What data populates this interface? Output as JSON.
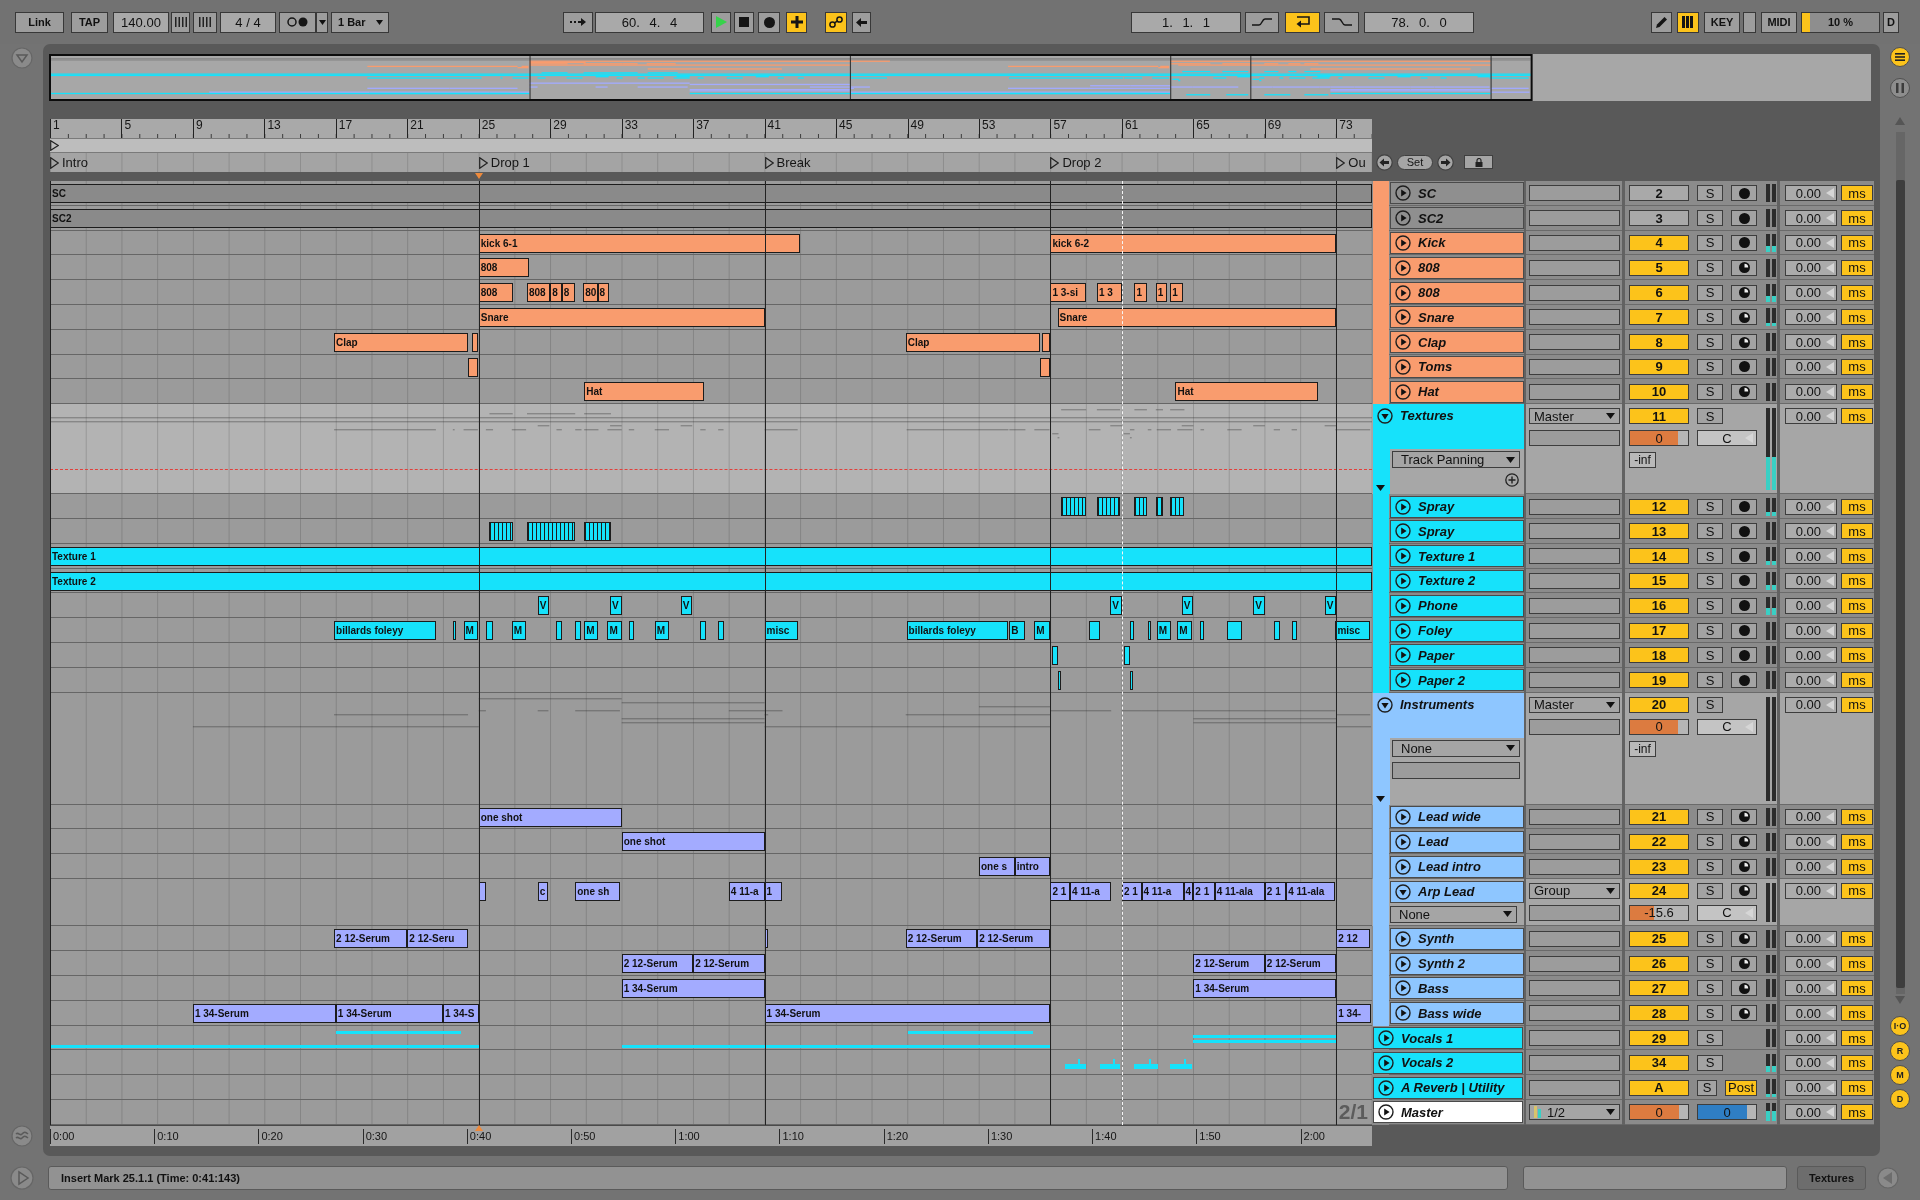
{
  "toolbar": {
    "link": {
      "label": "Link",
      "on": false
    },
    "tap": "TAP",
    "tempo": "140.00",
    "signature": "4 / 4",
    "metronome": {
      "on": false
    },
    "quantization": "1 Bar",
    "follow": {
      "on": false
    },
    "position": "60. 4. 4",
    "transport": [
      {
        "kind": "play",
        "on": true
      },
      {
        "kind": "stop",
        "on": false
      },
      {
        "kind": "record",
        "on": false
      },
      {
        "kind": "overdub",
        "on": true
      }
    ],
    "automation_arm": {
      "on": true
    },
    "back_to_arrangement": {
      "on": false
    },
    "loop_start": "1. 1. 1",
    "loop_switches": [
      {
        "kind": "punch-in",
        "on": false
      },
      {
        "kind": "loop",
        "on": true
      },
      {
        "kind": "punch-out",
        "on": false
      }
    ],
    "loop_length": "78. 0. 0",
    "draw_mode": {
      "on": false
    },
    "computer_keyboard": {
      "on": true
    },
    "key_map": {
      "label": "KEY",
      "on": false
    },
    "midi_map": {
      "label": "MIDI",
      "on": false
    },
    "cpu": {
      "reading": "10 %",
      "level": 0.1
    },
    "disk": {
      "label": "D",
      "on": false
    }
  },
  "overview_toggles": [
    {
      "kind": "lines",
      "on": true
    },
    {
      "kind": "columns",
      "on": false
    }
  ],
  "ruler": {
    "bars": [
      "1",
      "5",
      "9",
      "13",
      "17",
      "21",
      "25",
      "29",
      "33",
      "37",
      "41",
      "45",
      "49",
      "53",
      "57",
      "61",
      "65",
      "69",
      "73"
    ]
  },
  "locators": [
    {
      "label": "Intro"
    },
    {
      "label": "Drop 1"
    },
    {
      "label": "Break"
    },
    {
      "label": "Drop 2"
    },
    {
      "label": "Ou"
    }
  ],
  "locator_controls": {
    "set": "Set"
  },
  "grid": "2/1",
  "time_ruler": [
    "0:00",
    "0:10",
    "0:20",
    "0:30",
    "0:40",
    "0:50",
    "1:00",
    "1:10",
    "1:20",
    "1:30",
    "1:40",
    "1:50",
    "2:00"
  ],
  "tracks": [
    {
      "kind": "continuation",
      "color": "#f99c6e",
      "children": [
        {
          "kind": "track",
          "name": "SC",
          "color": "#8f8f8f",
          "expanded": false,
          "number": "2",
          "active": false,
          "solo": "S",
          "arm": {
            "kind": "dot"
          },
          "delay": "0.00",
          "unit": "ms",
          "clips": {
            "color": "#8a8a8a",
            "items": [
              {
                "kind": "block",
                "name": "SC"
              }
            ]
          }
        },
        {
          "kind": "track",
          "name": "SC2",
          "color": "#8f8f8f",
          "expanded": false,
          "number": "3",
          "active": false,
          "solo": "S",
          "arm": {
            "kind": "dot"
          },
          "delay": "0.00",
          "unit": "ms",
          "clips": {
            "color": "#8a8a8a",
            "items": [
              {
                "kind": "block",
                "name": "SC2"
              }
            ]
          }
        },
        {
          "kind": "track",
          "name": "Kick",
          "color": "#f99c6e",
          "expanded": false,
          "number": "4",
          "active": true,
          "solo": "S",
          "arm": {
            "kind": "dot"
          },
          "meter": {
            "level": 0.35
          },
          "delay": "0.00",
          "unit": "ms",
          "clips": {
            "color": "#f99c6e",
            "items": [
              {
                "kind": "block",
                "name": "kick 6-1"
              },
              {
                "kind": "block",
                "name": "kick 6-2"
              }
            ]
          }
        },
        {
          "kind": "track",
          "name": "808",
          "color": "#f99c6e",
          "expanded": false,
          "number": "5",
          "active": true,
          "solo": "S",
          "arm": {
            "kind": "clock"
          },
          "delay": "0.00",
          "unit": "ms",
          "clips": {
            "color": "#f99c6e",
            "items": [
              {
                "kind": "block",
                "name": "808"
              }
            ]
          }
        },
        {
          "kind": "track",
          "name": "808",
          "color": "#f99c6e",
          "expanded": false,
          "number": "6",
          "active": true,
          "solo": "S",
          "arm": {
            "kind": "clock"
          },
          "meter": {
            "level": 0.3
          },
          "delay": "0.00",
          "unit": "ms",
          "clips": {
            "color": "#f99c6e",
            "items": [
              {
                "kind": "block",
                "name": "808"
              },
              {
                "kind": "block",
                "name": "808"
              },
              {
                "kind": "block",
                "name": "8"
              },
              {
                "kind": "block",
                "name": "8"
              },
              {
                "kind": "block",
                "name": "80"
              },
              {
                "kind": "block",
                "name": "8"
              },
              {
                "kind": "block",
                "name": "1 3-si"
              },
              {
                "kind": "block",
                "name": "1 3"
              },
              {
                "kind": "block",
                "name": "1"
              },
              {
                "kind": "block",
                "name": "1"
              },
              {
                "kind": "block",
                "name": "1"
              }
            ]
          }
        },
        {
          "kind": "track",
          "name": "Snare",
          "color": "#f99c6e",
          "expanded": false,
          "number": "7",
          "active": true,
          "solo": "S",
          "arm": {
            "kind": "clock"
          },
          "meter": {
            "level": 0.2
          },
          "delay": "0.00",
          "unit": "ms",
          "clips": {
            "color": "#f99c6e",
            "items": [
              {
                "kind": "block",
                "name": "Snare"
              },
              {
                "kind": "block",
                "name": "Snare"
              }
            ]
          }
        },
        {
          "kind": "track",
          "name": "Clap",
          "color": "#f99c6e",
          "expanded": false,
          "number": "8",
          "active": true,
          "solo": "S",
          "arm": {
            "kind": "clock"
          },
          "delay": "0.00",
          "unit": "ms",
          "clips": {
            "color": "#f99c6e",
            "items": [
              {
                "kind": "block",
                "name": "Clap"
              },
              {
                "kind": "block"
              },
              {
                "kind": "block",
                "name": "Clap"
              },
              {
                "kind": "block"
              }
            ]
          }
        },
        {
          "kind": "track",
          "name": "Toms",
          "color": "#f99c6e",
          "expanded": false,
          "number": "9",
          "active": true,
          "solo": "S",
          "arm": {
            "kind": "dot"
          },
          "delay": "0.00",
          "unit": "ms",
          "clips": {
            "color": "#f99c6e",
            "items": [
              {
                "kind": "block"
              },
              {
                "kind": "block"
              }
            ]
          }
        },
        {
          "kind": "track",
          "name": "Hat",
          "color": "#f99c6e",
          "expanded": false,
          "number": "10",
          "active": true,
          "solo": "S",
          "arm": {
            "kind": "clock"
          },
          "delay": "0.00",
          "unit": "ms",
          "clips": {
            "color": "#f99c6e",
            "items": [
              {
                "kind": "block",
                "name": "Hat"
              },
              {
                "kind": "block",
                "name": "Hat"
              }
            ]
          }
        }
      ]
    },
    {
      "kind": "group",
      "name": "Textures",
      "color": "#16e2fb",
      "expanded": true,
      "output": "Master",
      "number": "11",
      "active": true,
      "solo": "S",
      "volume": {
        "value": "0",
        "level": 0.82
      },
      "pan": "C",
      "peak": "-inf",
      "automation": {
        "kind": "parameter",
        "chooser": "Track Panning"
      },
      "meter": {
        "level": 0.4
      },
      "delay": "0.00",
      "unit": "ms",
      "children": [
        {
          "kind": "track",
          "name": "Spray",
          "color": "#16e2fb",
          "expanded": false,
          "number": "12",
          "active": true,
          "solo": "S",
          "arm": {
            "kind": "dot"
          },
          "meter": {
            "level": 0.2
          },
          "delay": "0.00",
          "unit": "ms",
          "clips": {
            "color": "#16e2fb",
            "items": [
              {
                "kind": "sliced"
              },
              {
                "kind": "sliced"
              },
              {
                "kind": "sliced"
              },
              {
                "kind": "sliced"
              },
              {
                "kind": "sliced"
              }
            ]
          }
        },
        {
          "kind": "track",
          "name": "Spray",
          "color": "#16e2fb",
          "expanded": false,
          "number": "13",
          "active": true,
          "solo": "S",
          "arm": {
            "kind": "dot"
          },
          "delay": "0.00",
          "unit": "ms",
          "clips": {
            "color": "#16e2fb",
            "items": [
              {
                "kind": "sliced"
              },
              {
                "kind": "sliced"
              },
              {
                "kind": "sliced"
              }
            ]
          }
        },
        {
          "kind": "track",
          "name": "Texture 1",
          "color": "#16e2fb",
          "expanded": false,
          "number": "14",
          "active": true,
          "solo": "S",
          "arm": {
            "kind": "dot"
          },
          "meter": {
            "level": 0.25
          },
          "delay": "0.00",
          "unit": "ms",
          "clips": {
            "color": "#16e2fb",
            "items": [
              {
                "kind": "block",
                "name": "Texture 1"
              }
            ]
          }
        },
        {
          "kind": "track",
          "name": "Texture 2",
          "color": "#16e2fb",
          "expanded": false,
          "number": "15",
          "active": true,
          "solo": "S",
          "arm": {
            "kind": "dot"
          },
          "meter": {
            "level": 0.3
          },
          "delay": "0.00",
          "unit": "ms",
          "clips": {
            "color": "#16e2fb",
            "items": [
              {
                "kind": "block",
                "name": "Texture 2"
              }
            ]
          }
        },
        {
          "kind": "track",
          "name": "Phone",
          "color": "#16e2fb",
          "expanded": false,
          "number": "16",
          "active": true,
          "solo": "S",
          "arm": {
            "kind": "dot"
          },
          "meter": {
            "level": 0.35
          },
          "delay": "0.00",
          "unit": "ms",
          "clips": {
            "color": "#16e2fb",
            "items": [
              {
                "kind": "block",
                "name": "V"
              },
              {
                "kind": "block",
                "name": "V"
              },
              {
                "kind": "block",
                "name": "V"
              },
              {
                "kind": "block",
                "name": "V"
              },
              {
                "kind": "block",
                "name": "V"
              },
              {
                "kind": "block",
                "name": "V"
              },
              {
                "kind": "block",
                "name": "V"
              }
            ]
          }
        },
        {
          "kind": "track",
          "name": "Foley",
          "color": "#16e2fb",
          "expanded": false,
          "number": "17",
          "active": true,
          "solo": "S",
          "arm": {
            "kind": "dot"
          },
          "delay": "0.00",
          "unit": "ms",
          "clips": {
            "color": "#16e2fb",
            "items": [
              {
                "kind": "block",
                "name": "billards foleyy"
              },
              {
                "kind": "block"
              },
              {
                "kind": "block",
                "name": "M"
              },
              {
                "kind": "block"
              },
              {
                "kind": "block",
                "name": "M"
              },
              {
                "kind": "block"
              },
              {
                "kind": "block"
              },
              {
                "kind": "block",
                "name": "M"
              },
              {
                "kind": "block",
                "name": "M"
              },
              {
                "kind": "block"
              },
              {
                "kind": "block",
                "name": "M"
              },
              {
                "kind": "block"
              },
              {
                "kind": "block"
              },
              {
                "kind": "block",
                "name": "misc"
              },
              {
                "kind": "block",
                "name": "billards foleyy"
              },
              {
                "kind": "block",
                "name": "B"
              },
              {
                "kind": "block",
                "name": "M"
              },
              {
                "kind": "block"
              },
              {
                "kind": "block"
              },
              {
                "kind": "block"
              },
              {
                "kind": "block",
                "name": "M"
              },
              {
                "kind": "block",
                "name": "M"
              },
              {
                "kind": "block"
              },
              {
                "kind": "block"
              },
              {
                "kind": "block"
              },
              {
                "kind": "block"
              },
              {
                "kind": "block",
                "name": "misc"
              }
            ]
          }
        },
        {
          "kind": "track",
          "name": "Paper",
          "color": "#16e2fb",
          "expanded": false,
          "number": "18",
          "active": true,
          "solo": "S",
          "arm": {
            "kind": "dot"
          },
          "delay": "0.00",
          "unit": "ms",
          "clips": {
            "color": "#16e2fb",
            "items": [
              {
                "kind": "block"
              },
              {
                "kind": "block"
              }
            ]
          }
        },
        {
          "kind": "track",
          "name": "Paper 2",
          "color": "#16e2fb",
          "expanded": false,
          "number": "19",
          "active": true,
          "solo": "S",
          "arm": {
            "kind": "dot"
          },
          "delay": "0.00",
          "unit": "ms",
          "clips": {
            "color": "#16e2fb",
            "items": [
              {
                "kind": "block"
              },
              {
                "kind": "block"
              }
            ]
          }
        }
      ]
    },
    {
      "kind": "group",
      "name": "Instruments",
      "color": "#8ec6ff",
      "expanded": true,
      "output": "Master",
      "number": "20",
      "active": true,
      "solo": "S",
      "volume": {
        "value": "0",
        "level": 0.82
      },
      "pan": "C",
      "peak": "-inf",
      "automation": {
        "kind": "device",
        "chooser": "None"
      },
      "delay": "0.00",
      "unit": "ms",
      "children": [
        {
          "kind": "track",
          "name": "Lead wide",
          "color": "#8ec6ff",
          "expanded": false,
          "number": "21",
          "active": true,
          "solo": "S",
          "arm": {
            "kind": "clock"
          },
          "delay": "0.00",
          "unit": "ms",
          "clips": {
            "color": "#a3abff",
            "items": [
              {
                "kind": "block",
                "name": "one shot"
              }
            ]
          }
        },
        {
          "kind": "track",
          "name": "Lead",
          "color": "#8ec6ff",
          "expanded": false,
          "number": "22",
          "active": true,
          "solo": "S",
          "arm": {
            "kind": "clock"
          },
          "delay": "0.00",
          "unit": "ms",
          "clips": {
            "color": "#a3abff",
            "items": [
              {
                "kind": "block",
                "name": "one shot"
              }
            ]
          }
        },
        {
          "kind": "track",
          "name": "Lead intro",
          "color": "#8ec6ff",
          "expanded": false,
          "number": "23",
          "active": true,
          "solo": "S",
          "arm": {
            "kind": "clock"
          },
          "delay": "0.00",
          "unit": "ms",
          "clips": {
            "color": "#a3abff",
            "items": [
              {
                "kind": "block",
                "name": "one s"
              },
              {
                "kind": "block",
                "name": "intro"
              }
            ]
          }
        },
        {
          "kind": "track",
          "name": "Arp Lead",
          "color": "#8ec6ff",
          "expanded": true,
          "output": "Group",
          "number": "24",
          "active": true,
          "solo": "S",
          "arm": {
            "kind": "clock"
          },
          "volume": {
            "value": "-15.6",
            "level": 0.42
          },
          "pan": "C",
          "chooser": "None",
          "delay": "0.00",
          "unit": "ms",
          "clips": {
            "color": "#a3abff",
            "items": [
              {
                "kind": "block"
              },
              {
                "kind": "block",
                "name": "c"
              },
              {
                "kind": "block",
                "name": "one sh"
              },
              {
                "kind": "block",
                "name": "4 11-a"
              },
              {
                "kind": "block",
                "name": "1"
              },
              {
                "kind": "block",
                "name": "2 1"
              },
              {
                "kind": "block",
                "name": "4 11-a"
              },
              {
                "kind": "block",
                "name": "2 1"
              },
              {
                "kind": "block",
                "name": "4 11-a"
              },
              {
                "kind": "block",
                "name": "4"
              },
              {
                "kind": "block",
                "name": "2 1"
              },
              {
                "kind": "block",
                "name": "4 11-ala"
              },
              {
                "kind": "block",
                "name": "2 1"
              },
              {
                "kind": "block",
                "name": "4 11-ala"
              }
            ]
          }
        },
        {
          "kind": "track",
          "name": "Synth",
          "color": "#8ec6ff",
          "expanded": false,
          "number": "25",
          "active": true,
          "solo": "S",
          "arm": {
            "kind": "clock"
          },
          "delay": "0.00",
          "unit": "ms",
          "clips": {
            "color": "#a3abff",
            "items": [
              {
                "kind": "block",
                "name": "2 12-Serum"
              },
              {
                "kind": "block",
                "name": "2 12-Seru"
              },
              {
                "kind": "block"
              },
              {
                "kind": "block",
                "name": "2 12-Serum"
              },
              {
                "kind": "block",
                "name": "2 12-Serum"
              },
              {
                "kind": "block",
                "name": "2 12"
              }
            ]
          }
        },
        {
          "kind": "track",
          "name": "Synth 2",
          "color": "#8ec6ff",
          "expanded": false,
          "number": "26",
          "active": true,
          "solo": "S",
          "arm": {
            "kind": "clock"
          },
          "delay": "0.00",
          "unit": "ms",
          "clips": {
            "color": "#a3abff",
            "items": [
              {
                "kind": "block",
                "name": "2 12-Serum"
              },
              {
                "kind": "block",
                "name": "2 12-Serum"
              },
              {
                "kind": "block",
                "name": "2 12-Serum"
              },
              {
                "kind": "block",
                "name": "2 12-Serum"
              }
            ]
          }
        },
        {
          "kind": "track",
          "name": "Bass",
          "color": "#8ec6ff",
          "expanded": false,
          "number": "27",
          "active": true,
          "solo": "S",
          "arm": {
            "kind": "clock"
          },
          "delay": "0.00",
          "unit": "ms",
          "clips": {
            "color": "#a3abff",
            "items": [
              {
                "kind": "block",
                "name": "1 34-Serum"
              },
              {
                "kind": "block",
                "name": "1 34-Serum"
              }
            ]
          }
        },
        {
          "kind": "track",
          "name": "Bass wide",
          "color": "#8ec6ff",
          "expanded": false,
          "number": "28",
          "active": true,
          "solo": "S",
          "arm": {
            "kind": "clock"
          },
          "delay": "0.00",
          "unit": "ms",
          "clips": {
            "color": "#a3abff",
            "items": [
              {
                "kind": "block",
                "name": "1 34-Serum"
              },
              {
                "kind": "block",
                "name": "1 34-Serum"
              },
              {
                "kind": "block",
                "name": "1 34-S"
              },
              {
                "kind": "block",
                "name": "1 34-Serum"
              },
              {
                "kind": "block",
                "name": "1 34-"
              }
            ]
          }
        }
      ]
    },
    {
      "kind": "track",
      "name": "Vocals 1",
      "color": "#16e2fb",
      "expanded": false,
      "number": "29",
      "active": true,
      "solo": "S",
      "delay": "0.00",
      "unit": "ms",
      "clips": {
        "color": "#16e2fb",
        "items": [
          {
            "kind": "lower"
          },
          {
            "kind": "upper"
          },
          {
            "kind": "lower"
          },
          {
            "kind": "lower"
          },
          {
            "kind": "upper"
          },
          {
            "kind": "double"
          }
        ]
      }
    },
    {
      "kind": "track",
      "name": "Vocals 2",
      "color": "#16e2fb",
      "expanded": false,
      "number": "34",
      "active": true,
      "solo": "S",
      "meter": {
        "level": 0.35
      },
      "delay": "0.00",
      "unit": "ms",
      "clips": {
        "color": "#16e2fb",
        "items": [
          {
            "kind": "blip"
          },
          {
            "kind": "blip"
          },
          {
            "kind": "blip"
          },
          {
            "kind": "blip"
          }
        ]
      }
    },
    {
      "kind": "return",
      "name": "A Reverb | Utility",
      "color": "#16e2fb",
      "expanded": false,
      "number": "A",
      "active": true,
      "solo": "S",
      "post": {
        "label": "Post",
        "on": true
      },
      "meter": {
        "level": 0.15
      },
      "delay": "0.00",
      "unit": "ms"
    },
    {
      "kind": "master",
      "name": "Master",
      "color": "#ffffff",
      "expanded": false,
      "output": "1/2",
      "volume": {
        "value": "0",
        "level": 0.85
      },
      "cue": {
        "value": "0",
        "level": 0.85
      },
      "meter": {
        "level": 0.6
      },
      "delay": "0.00",
      "unit": "ms"
    }
  ],
  "view_toggles": [
    {
      "label": "I·O",
      "on": true
    },
    {
      "label": "R",
      "on": true
    },
    {
      "label": "M",
      "on": true
    },
    {
      "label": "D",
      "on": true
    }
  ],
  "status": {
    "message": "Insert Mark 25.1.1 (Time: 0:41:143)",
    "selected_track": "Textures"
  }
}
